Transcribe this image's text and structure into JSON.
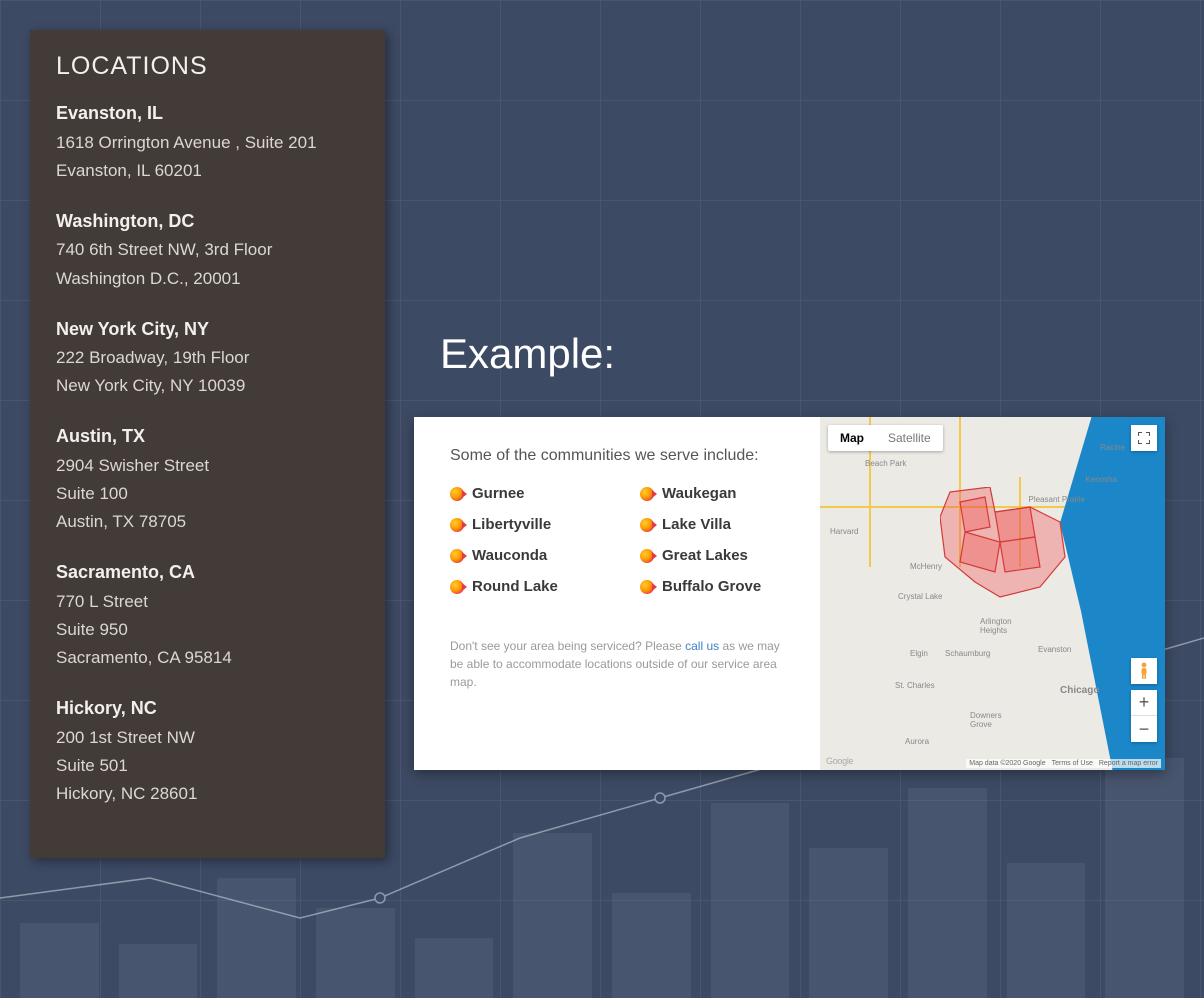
{
  "sidebar": {
    "title": "LOCATIONS",
    "locations": [
      {
        "name": "Evanston, IL",
        "line1": "1618 Orrington Avenue , Suite 201",
        "line2": "Evanston, IL 60201"
      },
      {
        "name": "Washington, DC",
        "line1": "740 6th Street NW, 3rd Floor",
        "line2": "Washington D.C., 20001"
      },
      {
        "name": "New York City, NY",
        "line1": "222 Broadway, 19th Floor",
        "line2": "New York City, NY 10039"
      },
      {
        "name": "Austin, TX",
        "line1": "2904 Swisher Street",
        "line2": "Suite 100",
        "line3": "Austin, TX 78705"
      },
      {
        "name": "Sacramento, CA",
        "line1": "770 L Street",
        "line2": "Suite 950",
        "line3": "Sacramento, CA 95814"
      },
      {
        "name": "Hickory, NC",
        "line1": "200 1st Street NW",
        "line2": "Suite 501",
        "line3": "Hickory, NC 28601"
      }
    ]
  },
  "example": {
    "label": "Example:",
    "intro": "Some of the communities we serve include:",
    "communities_col1": [
      "Gurnee",
      "Libertyville",
      "Wauconda",
      "Round Lake"
    ],
    "communities_col2": [
      "Waukegan",
      "Lake Villa",
      "Great Lakes",
      "Buffalo Grove"
    ],
    "note_prefix": "Don't see your area being serviced? Please ",
    "note_link": "call us",
    "note_suffix": " as we may be able to accommodate locations outside of our service area map."
  },
  "map": {
    "tab_map": "Map",
    "tab_satellite": "Satellite",
    "zoom_in": "+",
    "zoom_out": "−",
    "labels": [
      "Racine",
      "Kenosha",
      "Pleasant Prairie",
      "Harvard",
      "McHenry",
      "Crystal Lake",
      "Elgin",
      "Schaumburg",
      "Arlington Heights",
      "Evanston",
      "Chicago",
      "St. Charles",
      "Downers Grove",
      "Aurora",
      "Beach Park"
    ],
    "google": "Google",
    "attribution": "Map data ©2020 Google",
    "terms": "Terms of Use",
    "report": "Report a map error"
  }
}
